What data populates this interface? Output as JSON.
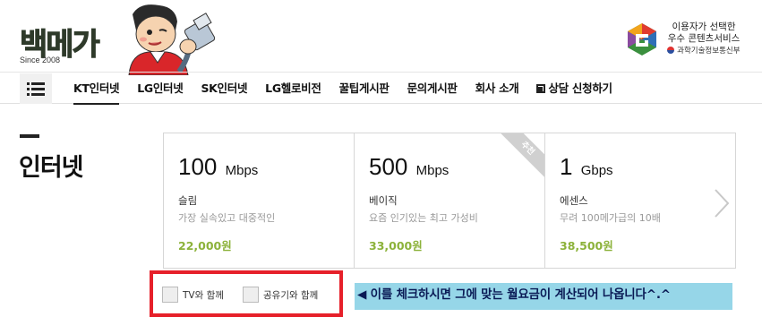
{
  "header": {
    "logo_text": "백메가",
    "logo_since": "Since 2008",
    "badge_line1": "이용자가 선택한",
    "badge_line2": "우수 콘텐츠서비스",
    "badge_line3": "과학기술정보통신부"
  },
  "nav": {
    "items": [
      {
        "label": "KT인터넷",
        "active": true
      },
      {
        "label": "LG인터넷"
      },
      {
        "label": "SK인터넷"
      },
      {
        "label": "LG헬로비전"
      },
      {
        "label": "꿀팁게시판"
      },
      {
        "label": "문의게시판"
      },
      {
        "label": "회사 소개"
      },
      {
        "label": "상담 신청하기",
        "icon": "edit-icon"
      }
    ]
  },
  "section": {
    "title": "인터넷"
  },
  "plans": [
    {
      "speed": "100",
      "unit": "Mbps",
      "name": "슬림",
      "desc": "가장 실속있고 대중적인",
      "price": "22,000원"
    },
    {
      "speed": "500",
      "unit": "Mbps",
      "name": "베이직",
      "desc": "요즘 인기있는 최고 가성비",
      "price": "33,000원",
      "ribbon": "추천"
    },
    {
      "speed": "1",
      "unit": "Gbps",
      "name": "에센스",
      "desc": "무려 100메가급의 10배",
      "price": "38,500원"
    }
  ],
  "options": {
    "tv": "TV와 함께",
    "router": "공유기와 함께"
  },
  "notice": "◀ 이를 체크하시면 그에 맞는 월요금이 계산되어 나옵니다^.^",
  "colors": {
    "price": "#8cb23a",
    "highlight_border": "#e6202a",
    "notice_bg": "#96d6e8"
  }
}
